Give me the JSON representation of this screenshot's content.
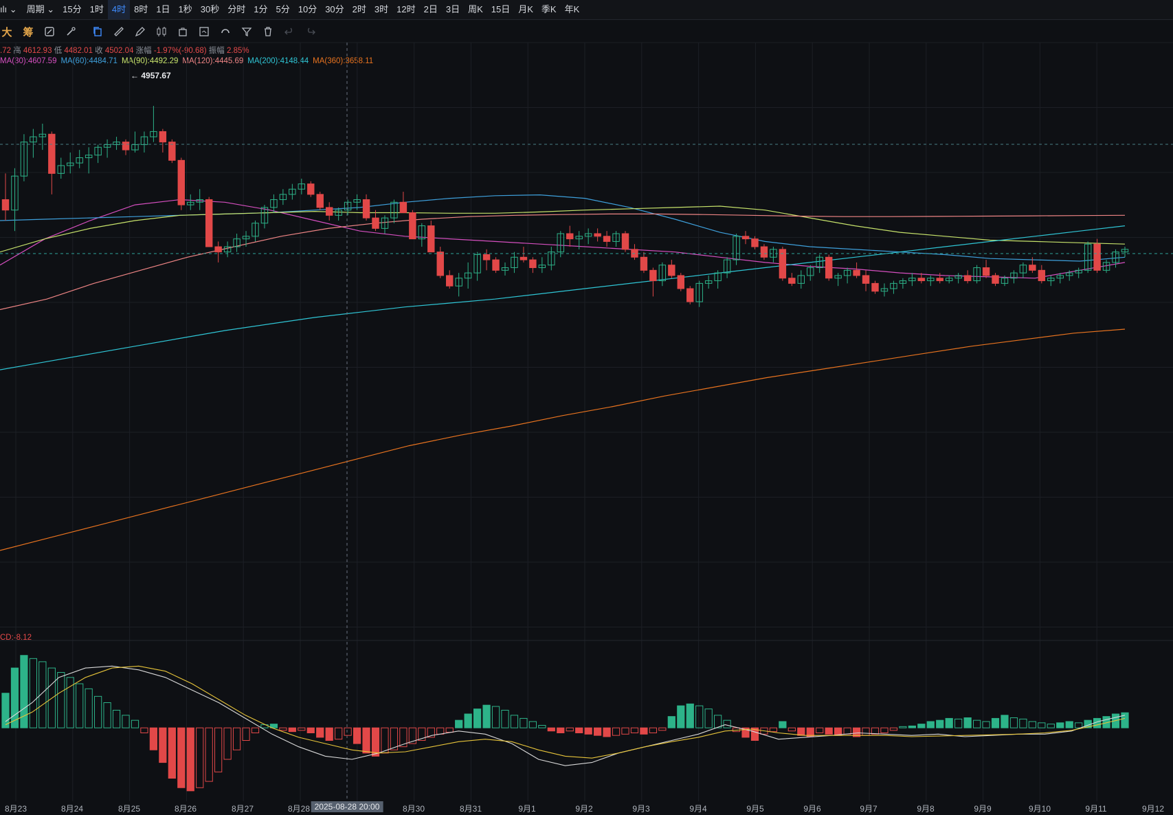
{
  "toolbar": {
    "items": [
      "周期",
      "15分",
      "1时",
      "4时",
      "8时",
      "1日",
      "1秒",
      "30秒",
      "分时",
      "1分",
      "5分",
      "10分",
      "30分",
      "2时",
      "3时",
      "12时",
      "2日",
      "3日",
      "周K",
      "15日",
      "月K",
      "季K",
      "年K"
    ],
    "active": "4时"
  },
  "drawbar": {
    "text_tools": [
      "大",
      "筹"
    ]
  },
  "ohlc": {
    "open_partial": ".72",
    "high_label": "高",
    "high": "4612.93",
    "low_label": "低",
    "low": "4482.01",
    "close_label": "收",
    "close": "4502.04",
    "change_label": "涨幅",
    "change": "-1.97%(-90.68)",
    "amplitude_label": "振幅",
    "amplitude": "2.85%"
  },
  "ma_legend": [
    {
      "text": "MA(30):4607.59",
      "color": "#d64fc0"
    },
    {
      "text": "MA(60):4484.71",
      "color": "#3ea0dc"
    },
    {
      "text": "MA(90):4492.29",
      "color": "#c7e36b"
    },
    {
      "text": "MA(120):4445.69",
      "color": "#ef8585"
    },
    {
      "text": "MA(200):4148.44",
      "color": "#2fc6d6"
    },
    {
      "text": "MA(360):3658.11",
      "color": "#e8731f"
    }
  ],
  "high_marker": "4957.67",
  "macd_label": "CD:-8.12",
  "crosshair_label": "2025-08-28 20:00",
  "colors": {
    "up": "#2db389",
    "down": "#e24848",
    "bg": "#0e1014",
    "grid": "#1c1f25"
  },
  "chart_data": {
    "type": "candlestick",
    "interval": "4时",
    "ylim": [
      3000,
      5100
    ],
    "x_labels": [
      "8月23",
      "8月24",
      "8月25",
      "8月26",
      "8月27",
      "8月28",
      "8月30",
      "8月31",
      "9月1",
      "9月2",
      "9月3",
      "9月4",
      "9月5",
      "9月6",
      "9月7",
      "9月8",
      "9月9",
      "9月10",
      "9月11",
      "9月12"
    ],
    "candles": [
      [
        4600,
        4700,
        4520,
        4560
      ],
      [
        4560,
        4720,
        4480,
        4690
      ],
      [
        4690,
        4850,
        4670,
        4820
      ],
      [
        4820,
        4870,
        4760,
        4840
      ],
      [
        4840,
        4890,
        4790,
        4850
      ],
      [
        4850,
        4860,
        4620,
        4700
      ],
      [
        4700,
        4760,
        4680,
        4730
      ],
      [
        4730,
        4780,
        4700,
        4740
      ],
      [
        4740,
        4790,
        4720,
        4760
      ],
      [
        4760,
        4800,
        4700,
        4770
      ],
      [
        4770,
        4810,
        4740,
        4800
      ],
      [
        4800,
        4830,
        4760,
        4810
      ],
      [
        4810,
        4840,
        4790,
        4820
      ],
      [
        4820,
        4830,
        4770,
        4790
      ],
      [
        4790,
        4860,
        4780,
        4810
      ],
      [
        4810,
        4860,
        4780,
        4840
      ],
      [
        4840,
        4958,
        4820,
        4860
      ],
      [
        4860,
        4870,
        4780,
        4820
      ],
      [
        4820,
        4830,
        4740,
        4750
      ],
      [
        4750,
        4760,
        4560,
        4580
      ],
      [
        4580,
        4620,
        4560,
        4590
      ],
      [
        4590,
        4640,
        4560,
        4600
      ],
      [
        4600,
        4610,
        4420,
        4420
      ],
      [
        4420,
        4440,
        4360,
        4400
      ],
      [
        4400,
        4440,
        4380,
        4420
      ],
      [
        4420,
        4470,
        4400,
        4450
      ],
      [
        4450,
        4480,
        4420,
        4460
      ],
      [
        4460,
        4520,
        4440,
        4510
      ],
      [
        4510,
        4580,
        4490,
        4570
      ],
      [
        4570,
        4620,
        4550,
        4600
      ],
      [
        4600,
        4640,
        4580,
        4620
      ],
      [
        4620,
        4660,
        4600,
        4640
      ],
      [
        4640,
        4680,
        4620,
        4660
      ],
      [
        4660,
        4670,
        4610,
        4620
      ],
      [
        4620,
        4630,
        4560,
        4570
      ],
      [
        4570,
        4590,
        4520,
        4540
      ],
      [
        4540,
        4570,
        4520,
        4560
      ],
      [
        4560,
        4600,
        4540,
        4590
      ],
      [
        4590,
        4620,
        4560,
        4600
      ],
      [
        4600,
        4620,
        4520,
        4530
      ],
      [
        4530,
        4560,
        4480,
        4490
      ],
      [
        4490,
        4540,
        4470,
        4530
      ],
      [
        4530,
        4600,
        4510,
        4590
      ],
      [
        4590,
        4630,
        4560,
        4550
      ],
      [
        4550,
        4560,
        4450,
        4450
      ],
      [
        4450,
        4510,
        4420,
        4500
      ],
      [
        4500,
        4520,
        4400,
        4400
      ],
      [
        4400,
        4420,
        4300,
        4310
      ],
      [
        4310,
        4330,
        4260,
        4270
      ],
      [
        4270,
        4320,
        4230,
        4300
      ],
      [
        4300,
        4360,
        4260,
        4320
      ],
      [
        4320,
        4400,
        4290,
        4390
      ],
      [
        4390,
        4410,
        4330,
        4370
      ],
      [
        4370,
        4380,
        4320,
        4330
      ],
      [
        4330,
        4360,
        4310,
        4340
      ],
      [
        4340,
        4400,
        4320,
        4380
      ],
      [
        4380,
        4420,
        4360,
        4370
      ],
      [
        4370,
        4380,
        4320,
        4340
      ],
      [
        4340,
        4380,
        4320,
        4350
      ],
      [
        4350,
        4420,
        4330,
        4400
      ],
      [
        4400,
        4480,
        4380,
        4470
      ],
      [
        4470,
        4500,
        4420,
        4450
      ],
      [
        4450,
        4480,
        4410,
        4460
      ],
      [
        4460,
        4490,
        4430,
        4470
      ],
      [
        4470,
        4490,
        4440,
        4460
      ],
      [
        4460,
        4480,
        4420,
        4440
      ],
      [
        4440,
        4480,
        4420,
        4470
      ],
      [
        4470,
        4480,
        4400,
        4410
      ],
      [
        4410,
        4430,
        4370,
        4380
      ],
      [
        4380,
        4400,
        4320,
        4330
      ],
      [
        4330,
        4340,
        4230,
        4290
      ],
      [
        4290,
        4360,
        4270,
        4350
      ],
      [
        4350,
        4370,
        4300,
        4310
      ],
      [
        4310,
        4320,
        4250,
        4260
      ],
      [
        4260,
        4270,
        4200,
        4210
      ],
      [
        4210,
        4290,
        4190,
        4280
      ],
      [
        4280,
        4310,
        4260,
        4290
      ],
      [
        4290,
        4330,
        4260,
        4320
      ],
      [
        4320,
        4380,
        4300,
        4370
      ],
      [
        4370,
        4470,
        4350,
        4460
      ],
      [
        4460,
        4480,
        4430,
        4450
      ],
      [
        4450,
        4460,
        4410,
        4420
      ],
      [
        4420,
        4430,
        4370,
        4380
      ],
      [
        4380,
        4420,
        4360,
        4410
      ],
      [
        4410,
        4420,
        4290,
        4300
      ],
      [
        4300,
        4320,
        4270,
        4280
      ],
      [
        4280,
        4330,
        4260,
        4310
      ],
      [
        4310,
        4350,
        4290,
        4340
      ],
      [
        4340,
        4390,
        4320,
        4380
      ],
      [
        4380,
        4390,
        4290,
        4300
      ],
      [
        4300,
        4320,
        4270,
        4310
      ],
      [
        4310,
        4340,
        4280,
        4330
      ],
      [
        4330,
        4360,
        4300,
        4310
      ],
      [
        4310,
        4330,
        4250,
        4280
      ],
      [
        4280,
        4290,
        4240,
        4250
      ],
      [
        4250,
        4280,
        4230,
        4260
      ],
      [
        4260,
        4290,
        4240,
        4280
      ],
      [
        4280,
        4300,
        4260,
        4290
      ],
      [
        4290,
        4320,
        4270,
        4300
      ],
      [
        4300,
        4320,
        4280,
        4290
      ],
      [
        4290,
        4310,
        4270,
        4300
      ],
      [
        4300,
        4320,
        4280,
        4290
      ],
      [
        4290,
        4310,
        4280,
        4300
      ],
      [
        4300,
        4320,
        4280,
        4310
      ],
      [
        4310,
        4330,
        4280,
        4290
      ],
      [
        4290,
        4350,
        4280,
        4340
      ],
      [
        4340,
        4370,
        4300,
        4310
      ],
      [
        4310,
        4320,
        4270,
        4280
      ],
      [
        4280,
        4310,
        4270,
        4300
      ],
      [
        4300,
        4330,
        4280,
        4320
      ],
      [
        4320,
        4360,
        4300,
        4350
      ],
      [
        4350,
        4380,
        4320,
        4330
      ],
      [
        4330,
        4350,
        4280,
        4290
      ],
      [
        4290,
        4310,
        4270,
        4300
      ],
      [
        4300,
        4320,
        4280,
        4310
      ],
      [
        4310,
        4330,
        4290,
        4320
      ],
      [
        4320,
        4340,
        4300,
        4330
      ],
      [
        4330,
        4440,
        4320,
        4430
      ],
      [
        4430,
        4450,
        4320,
        4330
      ],
      [
        4330,
        4370,
        4320,
        4360
      ],
      [
        4360,
        4410,
        4340,
        4400
      ],
      [
        4400,
        4420,
        4380,
        4410
      ]
    ],
    "ma_series": [
      {
        "name": "MA(30)",
        "color": "#d64fc0",
        "values": [
          4350,
          4450,
          4520,
          4580,
          4600,
          4590,
          4560,
          4520,
          4480,
          4460,
          4450,
          4440,
          4430,
          4420,
          4410,
          4400,
          4380,
          4360,
          4345,
          4335,
          4320,
          4310,
          4305,
          4300,
          4330,
          4360
        ]
      },
      {
        "name": "MA(60)",
        "color": "#3ea0dc",
        "values": [
          4520,
          4525,
          4530,
          4535,
          4540,
          4545,
          4550,
          4560,
          4570,
          4590,
          4605,
          4615,
          4618,
          4605,
          4570,
          4525,
          4475,
          4440,
          4420,
          4410,
          4400,
          4390,
          4375,
          4370,
          4365,
          4380
        ]
      },
      {
        "name": "MA(90)",
        "color": "#c7e36b",
        "values": [
          4400,
          4450,
          4490,
          4520,
          4540,
          4545,
          4550,
          4555,
          4550,
          4550,
          4548,
          4548,
          4553,
          4560,
          4565,
          4570,
          4575,
          4560,
          4530,
          4500,
          4475,
          4460,
          4445,
          4440,
          4435,
          4430
        ]
      },
      {
        "name": "MA(120)",
        "color": "#ef8585",
        "values": [
          4180,
          4220,
          4280,
          4330,
          4380,
          4420,
          4460,
          4490,
          4510,
          4525,
          4535,
          4540,
          4543,
          4545,
          4545,
          4543,
          4540,
          4537,
          4535,
          4535,
          4536,
          4537,
          4538,
          4539,
          4540
        ]
      },
      {
        "name": "MA(200)",
        "color": "#2fc6d6",
        "values": [
          3950,
          3980,
          4010,
          4040,
          4070,
          4100,
          4125,
          4150,
          4170,
          4190,
          4205,
          4220,
          4240,
          4260,
          4280,
          4300,
          4320,
          4340,
          4360,
          4380,
          4400,
          4420,
          4440,
          4460,
          4480,
          4500
        ]
      },
      {
        "name": "MA(360)",
        "color": "#e8731f",
        "values": [
          3260,
          3310,
          3360,
          3410,
          3460,
          3510,
          3560,
          3610,
          3660,
          3700,
          3735,
          3775,
          3810,
          3850,
          3885,
          3920,
          3950,
          3980,
          4010,
          4040,
          4065,
          4090,
          4105
        ]
      }
    ],
    "macd": {
      "ylim": [
        -110,
        130
      ],
      "histogram": [
        55,
        95,
        115,
        110,
        105,
        95,
        88,
        80,
        70,
        62,
        50,
        40,
        28,
        20,
        12,
        -8,
        -35,
        -55,
        -80,
        -95,
        -100,
        -95,
        -85,
        -70,
        -50,
        -35,
        -20,
        -8,
        5,
        6,
        -4,
        -6,
        -4,
        -8,
        -15,
        -20,
        -18,
        -12,
        -25,
        -40,
        -45,
        -40,
        -35,
        -30,
        -25,
        -20,
        -15,
        -10,
        -7,
        12,
        22,
        30,
        36,
        34,
        28,
        20,
        15,
        10,
        4,
        -5,
        -8,
        -5,
        -8,
        -10,
        -12,
        -14,
        -12,
        -10,
        -8,
        -10,
        -8,
        -4,
        18,
        35,
        38,
        35,
        30,
        20,
        12,
        -6,
        -15,
        -20,
        -10,
        -6,
        10,
        -5,
        -12,
        -14,
        -8,
        -10,
        -12,
        -10,
        -14,
        -12,
        -10,
        -8,
        -4,
        2,
        3,
        6,
        10,
        12,
        15,
        14,
        16,
        12,
        10,
        15,
        20,
        16,
        14,
        10,
        8,
        6,
        8,
        10,
        8,
        12,
        15,
        18,
        22,
        24
      ],
      "dif": [
        10,
        40,
        80,
        95,
        98,
        92,
        80,
        60,
        40,
        15,
        -10,
        -30,
        -45,
        -50,
        -40,
        -25,
        -12,
        -5,
        -10,
        -25,
        -50,
        -60,
        -55,
        -40,
        -30,
        -20,
        -10,
        5,
        -5,
        -18,
        -15,
        -12,
        -8,
        -10,
        -12,
        -10,
        -14,
        -12,
        -10,
        -10,
        -5,
        10,
        20
      ],
      "dea": [
        5,
        25,
        55,
        80,
        95,
        98,
        90,
        70,
        45,
        20,
        0,
        -15,
        -25,
        -35,
        -40,
        -38,
        -30,
        -22,
        -18,
        -22,
        -35,
        -45,
        -48,
        -40,
        -30,
        -22,
        -15,
        -5,
        -2,
        -8,
        -12,
        -12,
        -12,
        -12,
        -14,
        -13,
        -12,
        -11,
        -10,
        -8,
        -4,
        5,
        15
      ]
    }
  }
}
